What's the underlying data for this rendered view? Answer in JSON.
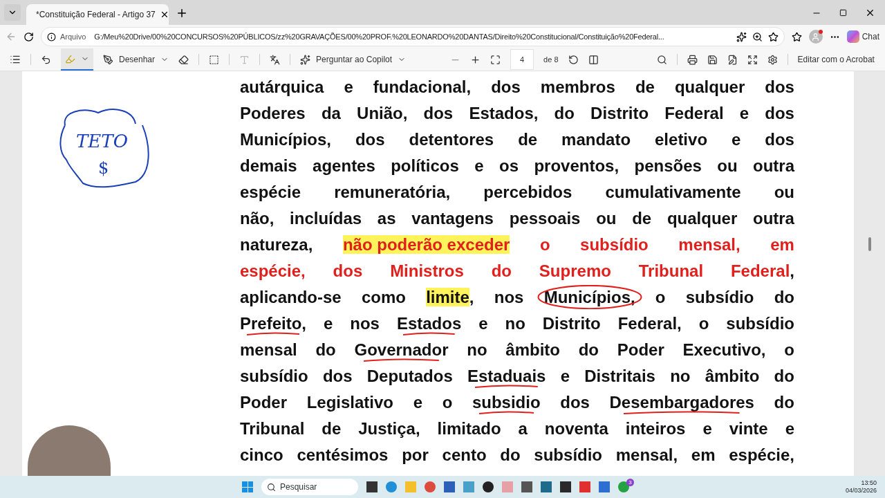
{
  "tab": {
    "title": "*Constituição Federal - Artigo 37",
    "selected": true
  },
  "address_bar": {
    "scheme_label": "Arquivo",
    "url": "G:/Meu%20Drive/00%20CONCURSOS%20PÚBLICOS/zz%20GRAVAÇÕES/00%20PROF.%20LEONARDO%20DANTAS/Direito%20Constitucional/Constituição%20Federal...",
    "chat_label": "Chat"
  },
  "pdf_toolbar": {
    "highlight_selected": true,
    "draw_label": "Desenhar",
    "copilot_label": "Perguntar ao Copilot",
    "page": "4",
    "page_total": "de 8",
    "edit_label": "Editar com o Acrobat"
  },
  "note": {
    "word": "TETO",
    "symbol": "$"
  },
  "document": {
    "lines": [
      [
        {
          "text": "autárquica e fundacional, dos membros de qualquer dos",
          "kind": "plain"
        }
      ],
      [
        {
          "text": "Poderes da União, dos Estados, do Distrito Federal e dos",
          "kind": "plain"
        }
      ],
      [
        {
          "text": "Municípios, dos detentores de mandato eletivo e dos",
          "kind": "plain"
        }
      ],
      [
        {
          "text": "demais agentes políticos e os proventos, pensões ou outra",
          "kind": "plain"
        }
      ],
      [
        {
          "text": "espécie remuneratória, percebidos cumulativamente ou",
          "kind": "plain"
        }
      ],
      [
        {
          "text": "não, incluídas as vantagens pessoais ou de qualquer outra",
          "kind": "plain"
        }
      ],
      [
        {
          "text": "natureza,",
          "kind": "plain"
        },
        {
          "text": "não poderão exceder",
          "kind": "marked_red"
        },
        {
          "text": "o subsídio mensal, em",
          "kind": "red"
        }
      ],
      [
        {
          "text": "espécie, dos Ministros do Supremo Tribunal Federal",
          "kind": "red"
        },
        {
          "text": ",",
          "kind": "plain"
        }
      ],
      [
        {
          "text": "aplicando-se como",
          "kind": "plain"
        },
        {
          "text": "limite",
          "kind": "marked"
        },
        {
          "text": ", nos",
          "kind": "plain"
        },
        {
          "text": "Municípios,",
          "kind": "circled"
        },
        {
          "text": "o subsídio do",
          "kind": "plain"
        }
      ],
      [
        {
          "text": "Prefeito,",
          "kind": "underlined"
        },
        {
          "text": "e nos",
          "kind": "plain"
        },
        {
          "text": "Estados",
          "kind": "underlined"
        },
        {
          "text": "e no Distrito Federal, o subsídio",
          "kind": "plain"
        }
      ],
      [
        {
          "text": "mensal do",
          "kind": "plain"
        },
        {
          "text": "Governador",
          "kind": "underlined"
        },
        {
          "text": "no âmbito do Poder Executivo, o",
          "kind": "plain"
        }
      ],
      [
        {
          "text": "subsídio dos Deputados",
          "kind": "plain"
        },
        {
          "text": "Estaduais",
          "kind": "underlined"
        },
        {
          "text": "e Distritais no âmbito do",
          "kind": "plain"
        }
      ],
      [
        {
          "text": "Poder Legislativo e o",
          "kind": "plain"
        },
        {
          "text": "subsidio",
          "kind": "underlined"
        },
        {
          "text": "dos",
          "kind": "plain"
        },
        {
          "text": "Desembargadores",
          "kind": "underlined"
        },
        {
          "text": "do",
          "kind": "plain"
        }
      ],
      [
        {
          "text": "Tribunal de Justiça, limitado a noventa inteiros e vinte e",
          "kind": "plain"
        }
      ],
      [
        {
          "text": "cinco centésimos por cento do subsídio mensal, em espécie,",
          "kind": "plain"
        }
      ]
    ]
  },
  "taskbar": {
    "search_placeholder": "Pesquisar",
    "whatsapp_badge": "3",
    "time": "13:50",
    "date": "04/03/2026"
  }
}
